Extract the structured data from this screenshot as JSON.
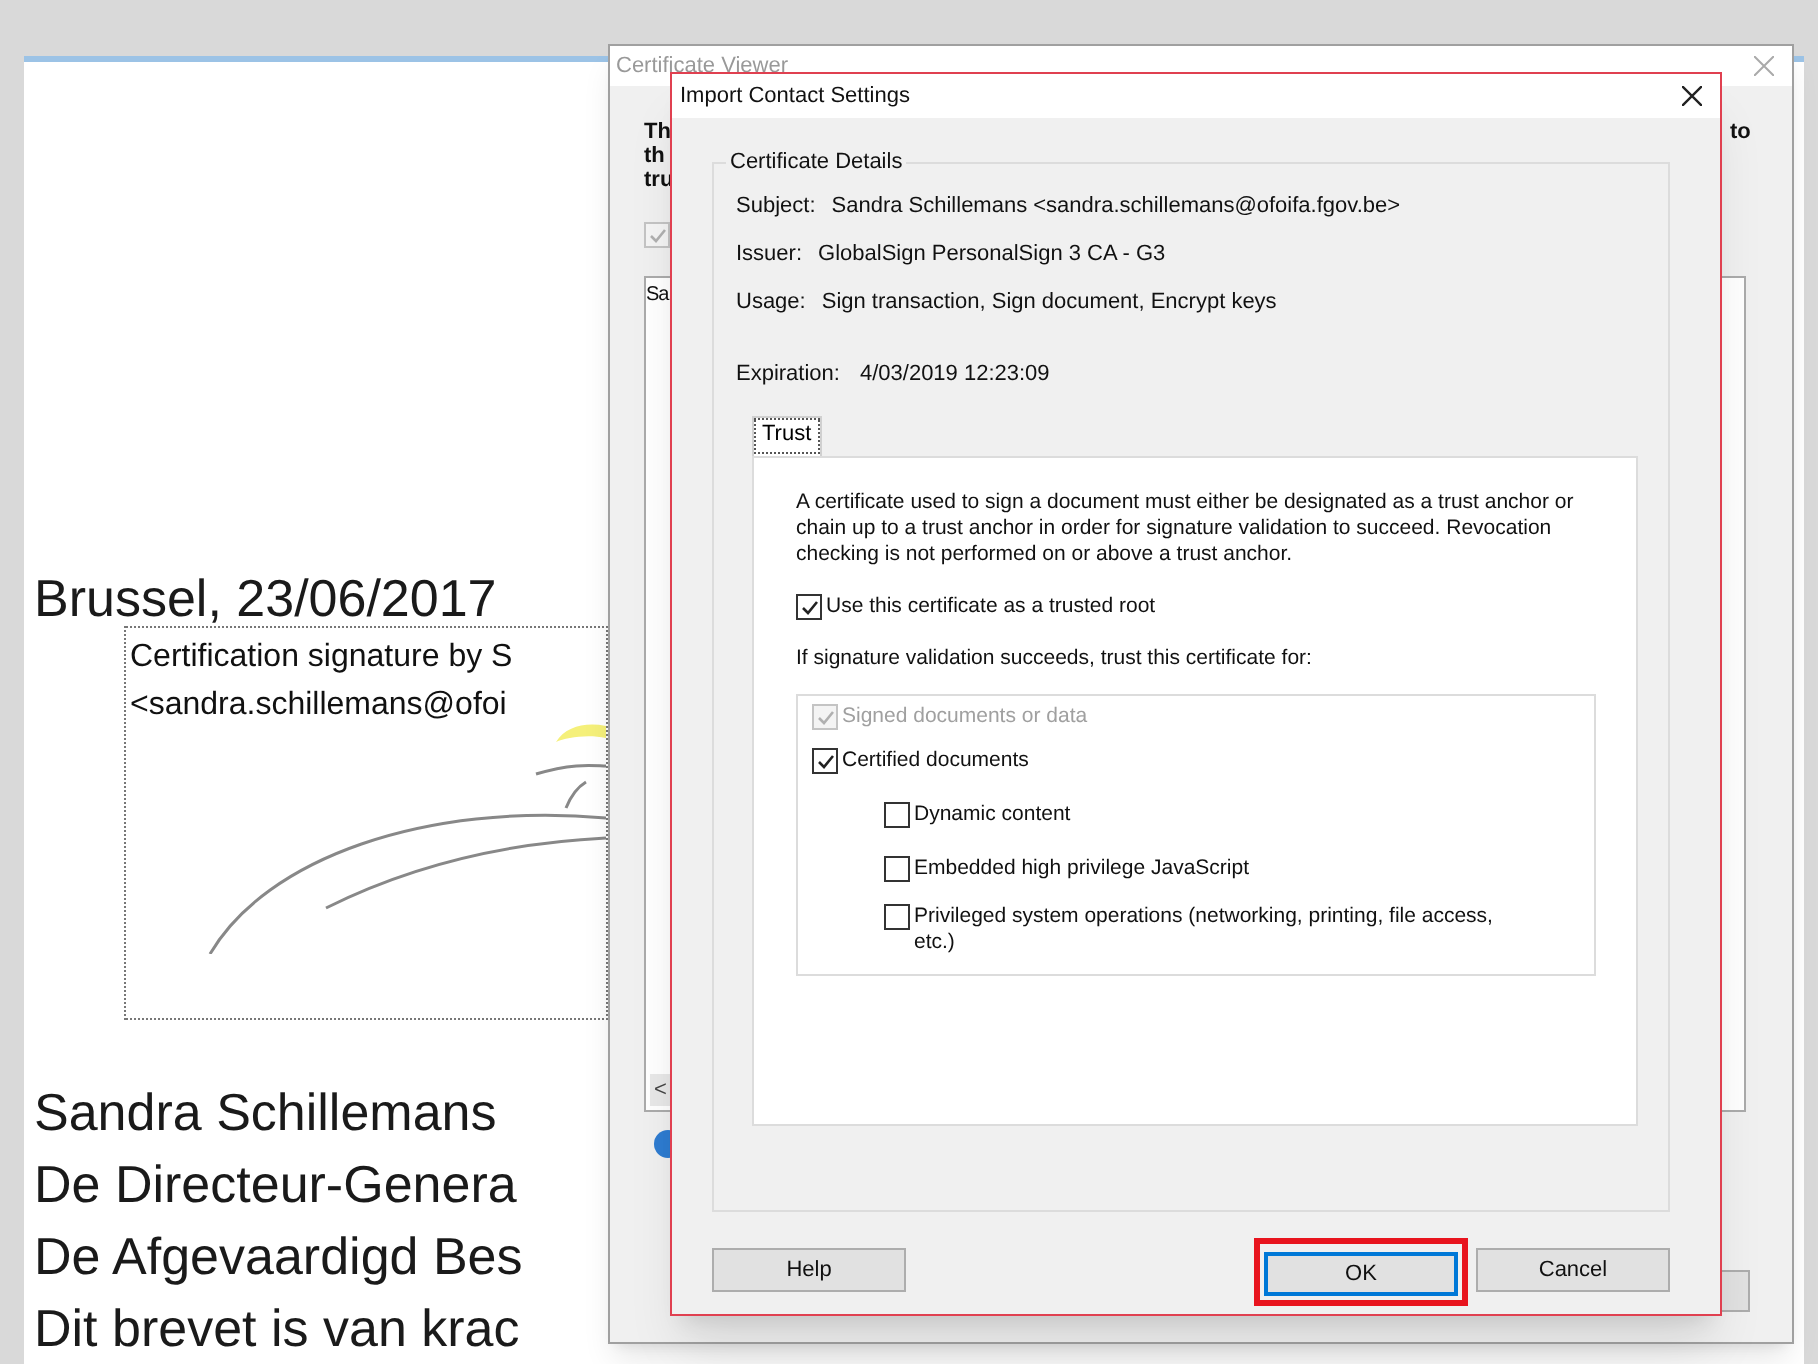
{
  "document": {
    "date_line": "Brussel, 23/06/2017",
    "signature_box": {
      "lines": [
        "Certification signature by S",
        "<sandra.schillemans@ofoi"
      ]
    },
    "lines": [
      "Sandra Schillemans",
      "De Directeur-Genera",
      "De Afgevaardigd Bes",
      "Dit brevet is van krac"
    ]
  },
  "certificate_viewer": {
    "title": "Certificate Viewer",
    "intro_left": [
      "Th",
      "th",
      "tru"
    ],
    "intro_right": "to",
    "checkbox": {
      "checked": true,
      "disabled": true
    },
    "list_fragment": "Sa",
    "scroll_arrow": "<"
  },
  "dialog": {
    "title": "Import Contact Settings",
    "group_title": "Certificate Details",
    "details": [
      {
        "label": "Subject:",
        "value": "Sandra Schillemans <sandra.schillemans@ofoifa.fgov.be>"
      },
      {
        "label": "Issuer:",
        "value": "GlobalSign PersonalSign 3 CA - G3"
      },
      {
        "label": "Usage:",
        "value": "Sign transaction, Sign document, Encrypt keys"
      }
    ],
    "expiration": {
      "label": "Expiration:",
      "value": "4/03/2019 12:23:09"
    },
    "tabs": [
      {
        "label": "Trust",
        "selected": true
      }
    ],
    "description": "A certificate used to sign a document must either be designated as a trust anchor or chain up to a trust anchor in order for signature validation to succeed.  Revocation checking is not performed on or above a trust anchor.",
    "trusted_root": {
      "label": "Use this certificate as a trusted root",
      "checked": true,
      "disabled": false
    },
    "trust_for_label": "If signature validation succeeds, trust this certificate for:",
    "trust_options": [
      {
        "label": "Signed documents or data",
        "checked": true,
        "disabled": true
      },
      {
        "label": "Certified documents",
        "checked": true,
        "disabled": false,
        "children": [
          {
            "label": "Dynamic content",
            "checked": false,
            "disabled": false
          },
          {
            "label": "Embedded high privilege JavaScript",
            "checked": false,
            "disabled": false
          },
          {
            "label": "Privileged system operations (networking, printing, file access, etc.)",
            "checked": false,
            "disabled": false
          }
        ]
      }
    ],
    "buttons": [
      {
        "label": "Help",
        "default": false,
        "highlighted": false
      },
      {
        "label": "OK",
        "default": true,
        "highlighted": true
      },
      {
        "label": "Cancel",
        "default": false,
        "highlighted": false
      }
    ]
  }
}
